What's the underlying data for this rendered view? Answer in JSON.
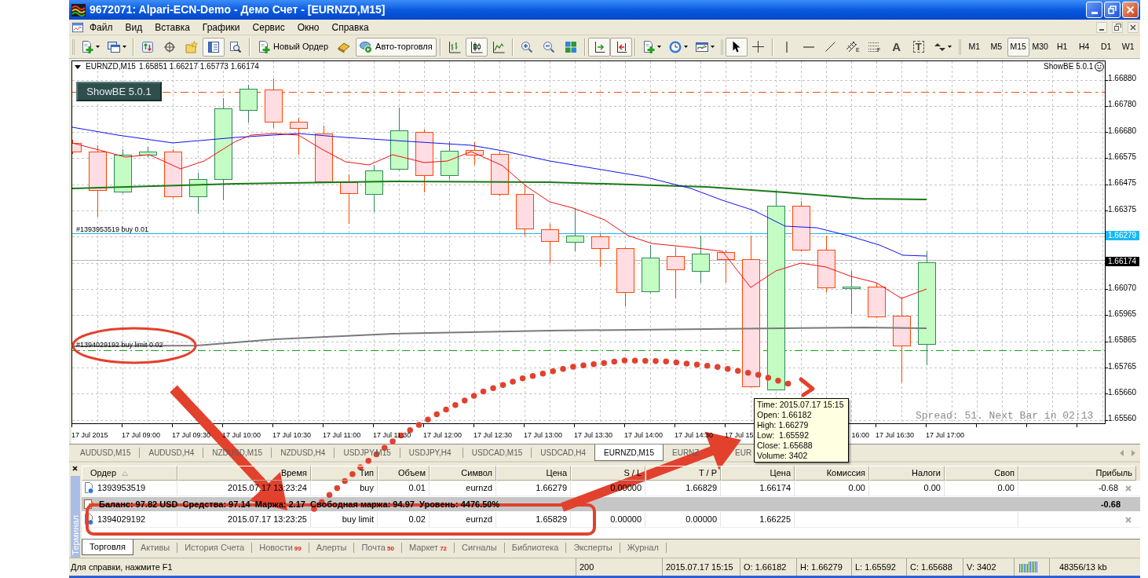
{
  "window": {
    "title": "9672071: Alpari-ECN-Demo - Демо Счет - [EURNZD,M15]"
  },
  "menu": [
    {
      "label": "Файл"
    },
    {
      "label": "Вид"
    },
    {
      "label": "Вставка"
    },
    {
      "label": "Графики"
    },
    {
      "label": "Сервис"
    },
    {
      "label": "Окно"
    },
    {
      "label": "Справка"
    }
  ],
  "toolbar": [
    {
      "kind": "grip"
    },
    {
      "kind": "new_chart",
      "pressed": false
    },
    {
      "kind": "profiles",
      "pressed": false
    },
    {
      "kind": "separator"
    },
    {
      "kind": "market_watch",
      "pressed": false
    },
    {
      "kind": "data_window",
      "pressed": false
    },
    {
      "kind": "navigator",
      "pressed": false
    },
    {
      "kind": "terminal",
      "pressed": true
    },
    {
      "kind": "tester",
      "pressed": false
    },
    {
      "kind": "separator"
    },
    {
      "kind": "new_order",
      "label": "Новый Ордер",
      "pressed": false
    },
    {
      "kind": "metaeditor",
      "pressed": false
    },
    {
      "kind": "autotrading",
      "label": "Авто-торговля",
      "pressed": true
    },
    {
      "kind": "separator"
    },
    {
      "kind": "bars",
      "pressed": false
    },
    {
      "kind": "candles",
      "pressed": true
    },
    {
      "kind": "line",
      "pressed": false
    },
    {
      "kind": "separator"
    },
    {
      "kind": "zoom_in",
      "pressed": false
    },
    {
      "kind": "zoom_out",
      "pressed": false
    },
    {
      "kind": "tile",
      "pressed": false
    },
    {
      "kind": "separator"
    },
    {
      "kind": "shift",
      "pressed": true
    },
    {
      "kind": "autoscroll",
      "pressed": true
    },
    {
      "kind": "separator"
    },
    {
      "kind": "indicators",
      "pressed": false
    },
    {
      "kind": "periods",
      "pressed": false
    },
    {
      "kind": "templates",
      "pressed": false
    },
    {
      "kind": "grip"
    },
    {
      "kind": "cursor",
      "pressed": true
    },
    {
      "kind": "crosshair",
      "pressed": false
    },
    {
      "kind": "separator"
    },
    {
      "kind": "vline",
      "pressed": false
    },
    {
      "kind": "hline",
      "pressed": false
    },
    {
      "kind": "trendline",
      "pressed": false
    },
    {
      "kind": "channel",
      "label": "E",
      "pressed": false
    },
    {
      "kind": "fibo",
      "label": "F",
      "pressed": false
    },
    {
      "kind": "text",
      "label": "A",
      "pressed": false
    },
    {
      "kind": "label",
      "label": "T",
      "pressed": false
    },
    {
      "kind": "arrows",
      "pressed": false
    },
    {
      "kind": "grip"
    }
  ],
  "timeframes": [
    {
      "label": "M1",
      "selected": false
    },
    {
      "label": "M5",
      "selected": false
    },
    {
      "label": "M15",
      "selected": true
    },
    {
      "label": "M30",
      "selected": false
    },
    {
      "label": "H1",
      "selected": false
    },
    {
      "label": "H4",
      "selected": false
    },
    {
      "label": "D1",
      "selected": false
    },
    {
      "label": "W1",
      "selected": false
    }
  ],
  "chart": {
    "symbol": "EURNZD,M15",
    "ohlc": "1.65851 1.66217 1.65773 1.66174",
    "indicator_button": "ShowBE 5.0.1",
    "indicator_label": "ShowBE 5.0.1",
    "order_lines": [
      {
        "label": "#1393953519 buy 0.01",
        "kind": "open"
      },
      {
        "label": "#1394029192 buy limit 0.02",
        "kind": "pending"
      }
    ],
    "spread_info": "Spread: 51. Next Bar in 02:13",
    "price_axis": [
      {
        "label": "1.66880",
        "kind": "tick"
      },
      {
        "label": "1.66780",
        "kind": "tick"
      },
      {
        "label": "1.66680",
        "kind": "tick"
      },
      {
        "label": "1.66575",
        "kind": "tick"
      },
      {
        "label": "1.66475",
        "kind": "tick"
      },
      {
        "label": "1.66375",
        "kind": "tick"
      },
      {
        "label": "1.66279",
        "kind": "order"
      },
      {
        "label": "1.66174",
        "kind": "bid"
      },
      {
        "label": "1.66070",
        "kind": "tick"
      },
      {
        "label": "1.65965",
        "kind": "tick"
      },
      {
        "label": "1.65865",
        "kind": "tick"
      },
      {
        "label": "1.65765",
        "kind": "tick"
      },
      {
        "label": "1.65660",
        "kind": "tick"
      },
      {
        "label": "1.65560",
        "kind": "tick"
      }
    ],
    "time_axis": [
      {
        "label": "17 Jul 2015",
        "kind": "whole"
      },
      {
        "label": "17 Jul 09:00",
        "kind": "whole"
      },
      {
        "label": "17 Jul 09:30",
        "kind": "whole"
      },
      {
        "label": "17 Jul 10:00",
        "kind": "whole"
      },
      {
        "label": "17 Jul 10:30",
        "kind": "whole"
      },
      {
        "label": "17 Jul 11:00",
        "kind": "whole"
      },
      {
        "label": "17 Jul 11:30",
        "kind": "whole"
      },
      {
        "label": "17 Jul 12:00",
        "kind": "whole"
      },
      {
        "label": "17 Jul 12:30",
        "kind": "whole"
      },
      {
        "label": "17 Jul 13:00",
        "kind": "whole"
      },
      {
        "label": "17 Jul 13:30",
        "kind": "whole"
      },
      {
        "label": "17 Jul 14:00",
        "kind": "whole"
      },
      {
        "label": "17 Jul 14:30",
        "kind": "whole"
      },
      {
        "label": "17 Jul 15",
        "kind": "head"
      },
      {
        "label": "16:00",
        "kind": "tail"
      },
      {
        "label": "17 Jul 16:30",
        "kind": "whole"
      },
      {
        "label": "17 Jul 17:00",
        "kind": "whole"
      }
    ],
    "tooltip": [
      "Time: 2015.07.17 15:15",
      "Open: 1.66182",
      "High: 1.66279",
      "Low:  1.65592",
      "Close: 1.65688",
      "Volume: 3402"
    ]
  },
  "chart_tabs": [
    {
      "label": "AUDUSD,M15",
      "selected": false
    },
    {
      "label": "AUDUSD,H4",
      "selected": false
    },
    {
      "label": "NZDUSD,M15",
      "selected": false
    },
    {
      "label": "NZDUSD,H4",
      "selected": false
    },
    {
      "label": "USDJPY,M15",
      "selected": false
    },
    {
      "label": "USDJPY,H4",
      "selected": false
    },
    {
      "label": "USDCAD,M15",
      "selected": false
    },
    {
      "label": "USDCAD,H4",
      "selected": false
    },
    {
      "label": "EURNZD,M15",
      "selected": true
    },
    {
      "label": "EURNZ",
      "selected": false
    },
    {
      "label": "EUR",
      "selected": false
    }
  ],
  "terminal": {
    "side_label": "Терминал",
    "columns": [
      {
        "label": "Ордер",
        "sorted": true
      },
      {
        "label": "Время",
        "sorted": false
      },
      {
        "label": "Тип",
        "sorted": false
      },
      {
        "label": "Объем",
        "sorted": false
      },
      {
        "label": "Символ",
        "sorted": false
      },
      {
        "label": "Цена",
        "sorted": false
      },
      {
        "label": "S / L",
        "sorted": false
      },
      {
        "label": "T / P",
        "sorted": false
      },
      {
        "label": "Цена",
        "sorted": false
      },
      {
        "label": "Комиссия",
        "sorted": false
      },
      {
        "label": "Налоги",
        "sorted": false
      },
      {
        "label": "Своп",
        "sorted": false
      },
      {
        "label": "Прибыль",
        "sorted": false
      }
    ],
    "rows": [
      {
        "kind": "order",
        "cells": [
          "1393953519",
          "2015.07.17 13:23:24",
          "buy",
          "0.01",
          "eurnzd",
          "1.66279",
          "0.00000",
          "1.66829",
          "1.66174",
          "0.00",
          "0.00",
          "0.00",
          "-0.68"
        ]
      },
      {
        "kind": "balance",
        "text": "Баланс: 97.82 USD  Средства: 97.14  Маржа: 2.17  Свободная маржа: 94.97  Уровень: 4476.50%",
        "total": "-0.68"
      },
      {
        "kind": "order",
        "cells": [
          "1394029192",
          "2015.07.17 13:23:25",
          "buy limit",
          "0.02",
          "eurnzd",
          "1.65829",
          "0.00000",
          "0.00000",
          "1.66225"
        ]
      }
    ],
    "tabs": [
      {
        "label": "Торговля",
        "selected": true
      },
      {
        "label": "Активы",
        "selected": false
      },
      {
        "label": "История Счета",
        "selected": false
      },
      {
        "label": "Новости",
        "badge": "99",
        "selected": false
      },
      {
        "label": "Алерты",
        "selected": false
      },
      {
        "label": "Почта",
        "badge": "50",
        "selected": false
      },
      {
        "label": "Маркет",
        "badge": "72",
        "selected": false
      },
      {
        "label": "Сигналы",
        "selected": false
      },
      {
        "label": "Библиотека",
        "selected": false
      },
      {
        "label": "Эксперты",
        "selected": false
      },
      {
        "label": "Журнал",
        "selected": false
      }
    ]
  },
  "status_bar": {
    "help": "Для справки, нажмите F1",
    "fields": [
      "200",
      "2015.07.17 15:15",
      "O: 1.66182",
      "H: 1.66279",
      "L: 1.65592",
      "C: 1.65688",
      "V: 3402"
    ],
    "traffic": "48356/13 kb"
  }
}
